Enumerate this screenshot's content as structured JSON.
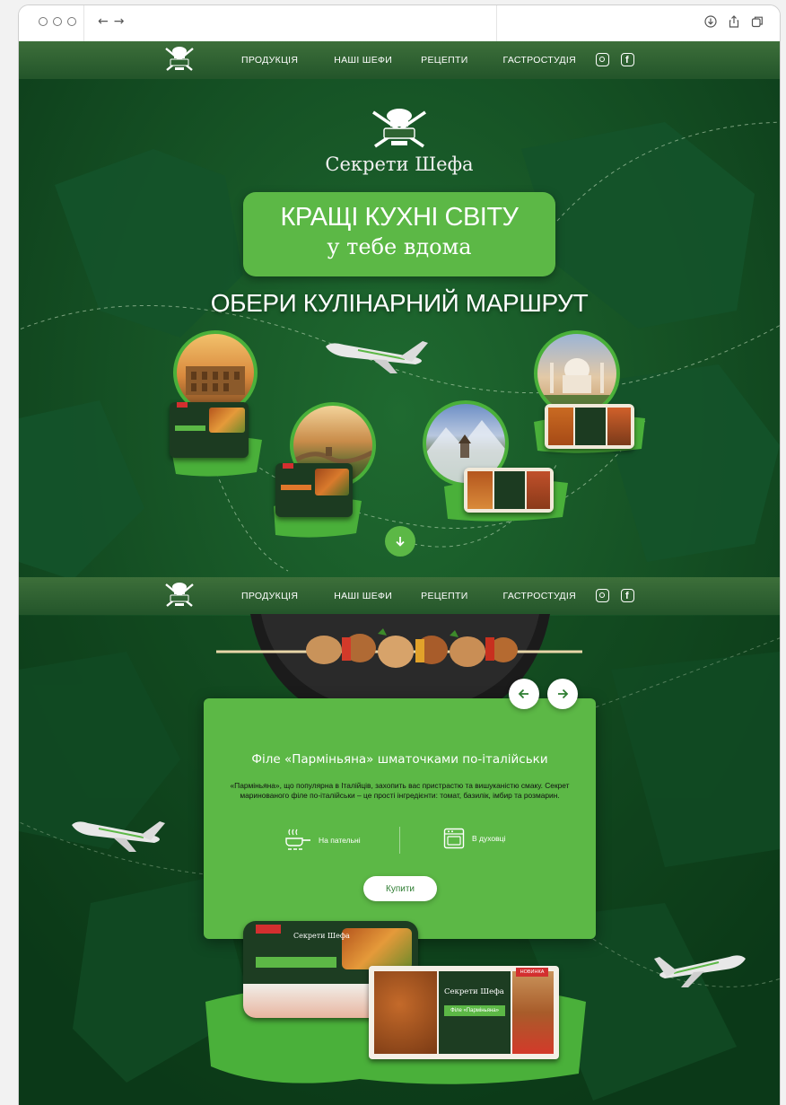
{
  "browser": {
    "back_icon": "←",
    "forward_icon": "→",
    "right_icons": [
      "download-icon",
      "share-icon",
      "tabs-icon"
    ]
  },
  "nav": {
    "items": [
      {
        "label": "ПРОДУКЦІЯ"
      },
      {
        "label": "НАШІ ШЕФИ"
      },
      {
        "label": "РЕЦЕПТИ"
      },
      {
        "label": "ГАСТРОСТУДІЯ"
      }
    ],
    "social": [
      "instagram-icon",
      "facebook-icon"
    ]
  },
  "hero": {
    "brand": "Секрети Шефа",
    "headline_line1": "КРАЩІ КУХНІ СВІТУ",
    "headline_line2": "у тебе вдома",
    "route_title": "ОБЕРИ КУЛІНАРНИЙ МАРШРУТ",
    "destinations": [
      "Колізей",
      "Велика китайська стіна",
      "Грузинські гори",
      "Тадж-Махал"
    ]
  },
  "product": {
    "title": "Філе «Парміньяна» шматочками по-італійськи",
    "description": "«Парміньяна», що популярна в Італійців, захопить вас пристрастю та вишуканістю смаку. Секрет маринованого філе по-італійськи – це прості інгредієнти: томат, базилік, імбир та розмарин.",
    "features": [
      {
        "label": "На пательні",
        "icon": "frying-pan-icon"
      },
      {
        "label": "В духовці",
        "icon": "oven-icon"
      }
    ],
    "buy_label": "Купити",
    "package": {
      "brand": "Секрети Шефа",
      "badge": "НОВИНКА",
      "name": "Філе «Парміньяна»"
    }
  },
  "colors": {
    "accent": "#5cb846",
    "dark_green": "#0f4620",
    "nav_green": "#2f6432"
  }
}
